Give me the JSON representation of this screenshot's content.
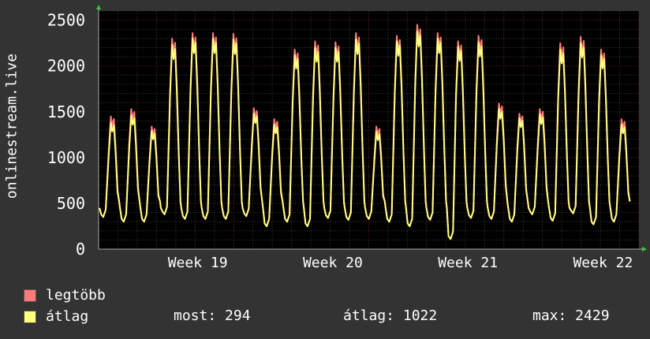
{
  "chart_data": {
    "type": "line",
    "ylabel": "onlinestream.live",
    "ylim": [
      0,
      2600
    ],
    "yticks": [
      0,
      500,
      1000,
      1500,
      2000,
      2500
    ],
    "xlim": [
      0,
      28
    ],
    "xticks": [
      {
        "label": "Week 19",
        "pos": 7
      },
      {
        "label": "Week 20",
        "pos": 14
      },
      {
        "label": "Week 21",
        "pos": 21
      },
      {
        "label": "Week 22",
        "pos": 28
      }
    ],
    "grid": true,
    "daily_peaks": {
      "max": [
        1450,
        1530,
        1340,
        2300,
        2360,
        2360,
        2350,
        1540,
        1420,
        2180,
        2270,
        2260,
        2360,
        1340,
        2330,
        2450,
        2360,
        2270,
        2330,
        1590,
        1480,
        1530,
        2250,
        2320,
        2180,
        1420
      ],
      "avg": [
        1380,
        1460,
        1290,
        2230,
        2300,
        2300,
        2290,
        1480,
        1360,
        2120,
        2200,
        2200,
        2290,
        1280,
        2270,
        2380,
        2300,
        2210,
        2260,
        1530,
        1430,
        1470,
        2180,
        2250,
        2120,
        1360
      ],
      "trough": [
        350,
        300,
        300,
        380,
        330,
        330,
        330,
        360,
        250,
        300,
        250,
        340,
        320,
        330,
        300,
        250,
        320,
        110,
        340,
        330,
        300,
        380,
        310,
        390,
        270,
        300
      ]
    },
    "series": [
      {
        "name": "legtöbb",
        "color": "#ff7b7b"
      },
      {
        "name": "átlag",
        "color": "#ffff80"
      }
    ]
  },
  "legend": [
    {
      "label": "legtöbb",
      "color": "#ff7b7b"
    },
    {
      "label": "átlag",
      "color": "#ffff80"
    }
  ],
  "stats": {
    "now": "most: 294",
    "avg": "átlag: 1022",
    "max": "max: 2429"
  }
}
